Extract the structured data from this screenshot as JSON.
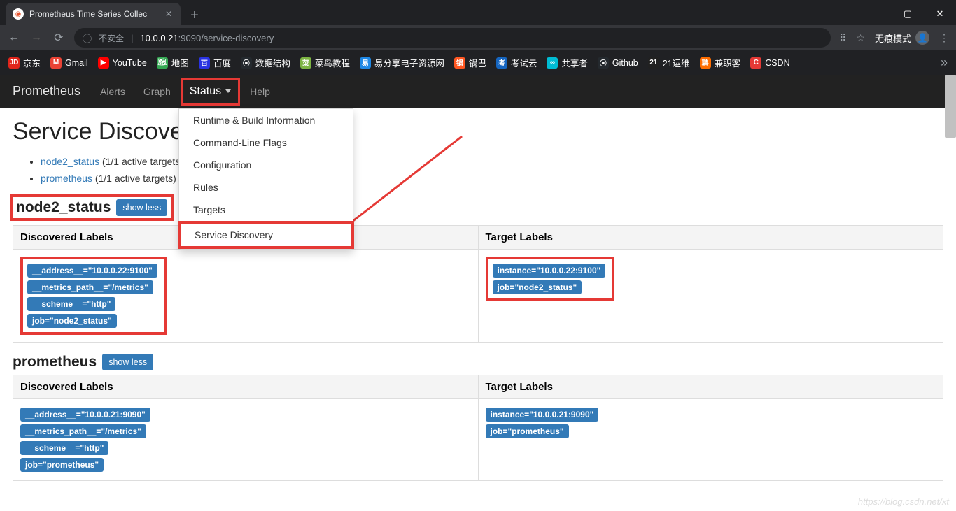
{
  "browser": {
    "tab_title": "Prometheus Time Series Collec",
    "secure_label": "不安全",
    "url_host": "10.0.0.21",
    "url_port": ":9090",
    "url_path": "/service-discovery",
    "incognito_label": "无痕模式"
  },
  "bookmarks": [
    {
      "icon": "JD",
      "bg": "#e1251b",
      "label": "京东"
    },
    {
      "icon": "M",
      "bg": "#ea4335",
      "label": "Gmail"
    },
    {
      "icon": "▶",
      "bg": "#ff0000",
      "label": "YouTube"
    },
    {
      "icon": "🗺",
      "bg": "#34a853",
      "label": "地图"
    },
    {
      "icon": "百",
      "bg": "#2932e1",
      "label": "百度"
    },
    {
      "icon": "⦿",
      "bg": "#24292e",
      "label": "数据结构"
    },
    {
      "icon": "菜",
      "bg": "#7cb342",
      "label": "菜鸟教程"
    },
    {
      "icon": "易",
      "bg": "#1e88e5",
      "label": "易分享电子资源网"
    },
    {
      "icon": "锅",
      "bg": "#ff5722",
      "label": "锅巴"
    },
    {
      "icon": "考",
      "bg": "#1565c0",
      "label": "考试云"
    },
    {
      "icon": "∞",
      "bg": "#00bcd4",
      "label": "共享者"
    },
    {
      "icon": "⦿",
      "bg": "#24292e",
      "label": "Github"
    },
    {
      "icon": "21",
      "bg": "#212121",
      "label": "21运维"
    },
    {
      "icon": "聘",
      "bg": "#ff6d00",
      "label": "兼职客"
    },
    {
      "icon": "C",
      "bg": "#e53935",
      "label": "CSDN"
    }
  ],
  "nav": {
    "brand": "Prometheus",
    "alerts": "Alerts",
    "graph": "Graph",
    "status": "Status",
    "help": "Help"
  },
  "status_menu": [
    "Runtime & Build Information",
    "Command-Line Flags",
    "Configuration",
    "Rules",
    "Targets",
    "Service Discovery"
  ],
  "page_title": "Service Discovery",
  "summary": [
    {
      "link": "node2_status",
      "rest": " (1/1 active targets)"
    },
    {
      "link": "prometheus",
      "rest": " (1/1 active targets)"
    }
  ],
  "th_discovered": "Discovered Labels",
  "th_target": "Target Labels",
  "show_less": "show less",
  "jobs": [
    {
      "name": "node2_status",
      "highlight": true,
      "discovered": [
        "__address__=\"10.0.0.22:9100\"",
        "__metrics_path__=\"/metrics\"",
        "__scheme__=\"http\"",
        "job=\"node2_status\""
      ],
      "target": [
        "instance=\"10.0.0.22:9100\"",
        "job=\"node2_status\""
      ]
    },
    {
      "name": "prometheus",
      "highlight": false,
      "discovered": [
        "__address__=\"10.0.0.21:9090\"",
        "__metrics_path__=\"/metrics\"",
        "__scheme__=\"http\"",
        "job=\"prometheus\""
      ],
      "target": [
        "instance=\"10.0.0.21:9090\"",
        "job=\"prometheus\""
      ]
    }
  ],
  "watermark": "https://blog.csdn.net/xt"
}
